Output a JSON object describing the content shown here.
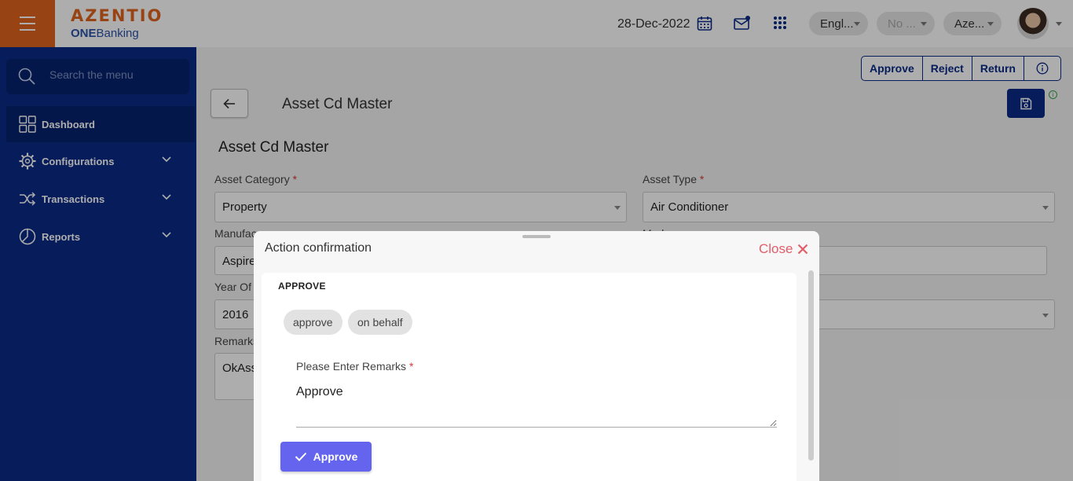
{
  "header": {
    "brand": "AZENTIO",
    "product_prefix": "ONE",
    "product_suffix": "Banking",
    "date": "28-Dec-2022",
    "language": "Engl...",
    "branch": "No ...",
    "entity": "Aze..."
  },
  "sidebar": {
    "search_placeholder": "Search the menu",
    "items": [
      {
        "label": "Dashboard",
        "icon": "grid-icon"
      },
      {
        "label": "Configurations",
        "icon": "gear-icon"
      },
      {
        "label": "Transactions",
        "icon": "shuffle-icon"
      },
      {
        "label": "Reports",
        "icon": "pie-chart-icon"
      }
    ]
  },
  "toolbar": {
    "approve": "Approve",
    "reject": "Reject",
    "return": "Return"
  },
  "page": {
    "title": "Asset Cd Master",
    "form_title": "Asset Cd Master"
  },
  "form": {
    "asset_category": {
      "label": "Asset Category",
      "value": "Property"
    },
    "asset_type": {
      "label": "Asset Type",
      "value": "Air Conditioner"
    },
    "manufacturer": {
      "label": "Manufac",
      "value": "Aspire"
    },
    "model": {
      "label": "Mod"
    },
    "year": {
      "label": "Year Of",
      "value": "2016"
    },
    "remarks": {
      "label": "Remarks",
      "value": "OkAss"
    }
  },
  "modal": {
    "title": "Action confirmation",
    "close_label": "Close",
    "section_heading": "APPROVE",
    "chips": [
      "approve",
      "on behalf"
    ],
    "remarks_label": "Please Enter Remarks",
    "remarks_value": "Approve",
    "submit_label": "Approve"
  },
  "colors": {
    "sidebar": "#0a2a86",
    "brand_orange": "#e0641e",
    "close_red": "#e35d6a",
    "submit_purple": "#6464ee"
  }
}
